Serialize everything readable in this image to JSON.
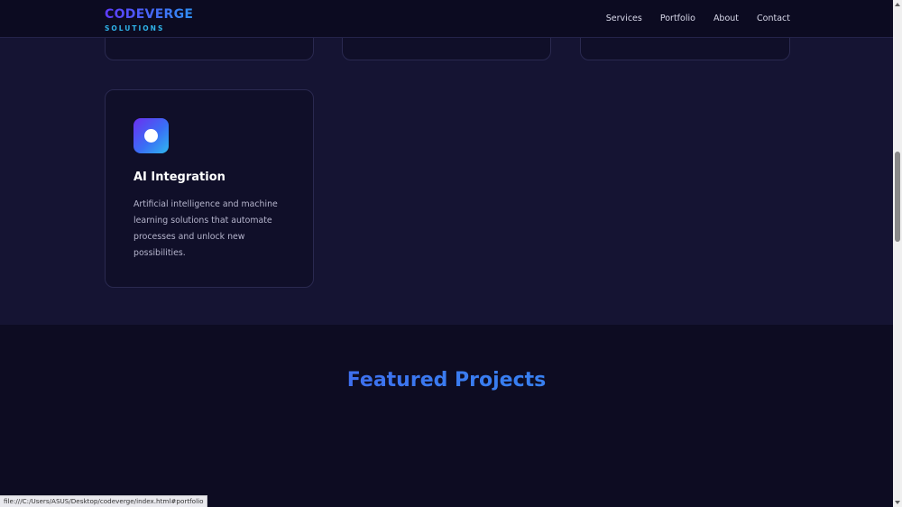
{
  "brand": {
    "title": "CODEVERGE",
    "subtitle": "SOLUTIONS"
  },
  "nav": {
    "items": [
      {
        "label": "Services"
      },
      {
        "label": "Portfolio"
      },
      {
        "label": "About"
      },
      {
        "label": "Contact"
      }
    ]
  },
  "services": {
    "ai_card": {
      "title": "AI Integration",
      "description": "Artificial intelligence and machine learning solutions that automate processes and unlock new possibilities.",
      "icon": "ai-dot-icon"
    }
  },
  "projects": {
    "heading": "Featured Projects"
  },
  "status_bar": {
    "url": "file:///C:/Users/ASUS/Desktop/codeverge/index.html#portfolio"
  },
  "colors": {
    "page_bg": "#151433",
    "projects_bg": "#0d0c22",
    "navbar_bg": "#0c0b21",
    "card_bg": "#100f29",
    "accent_purple": "#5f3bff",
    "accent_blue": "#2f8ff2",
    "accent_cyan": "#2fb4ea"
  }
}
